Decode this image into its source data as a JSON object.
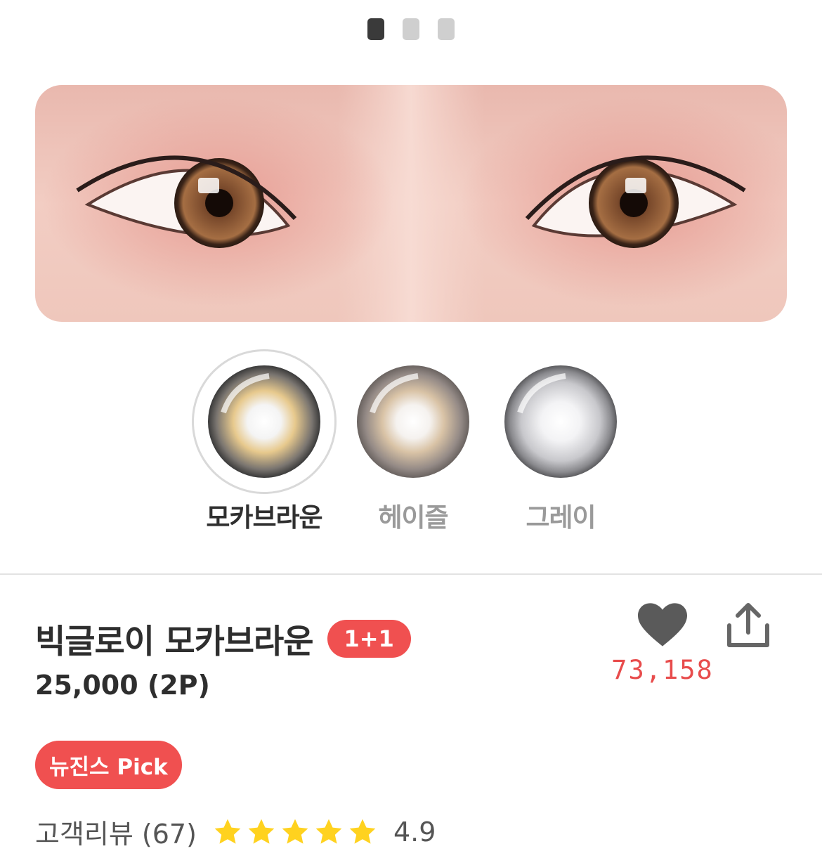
{
  "carousel": {
    "count": 3,
    "active_index": 0
  },
  "colors": {
    "accent": "#f05050",
    "like_count": "#e84c4c",
    "heart": "#5a5a5a"
  },
  "swatches": [
    {
      "label": "모카브라운",
      "selected": true
    },
    {
      "label": "헤이즐",
      "selected": false
    },
    {
      "label": "그레이",
      "selected": false
    }
  ],
  "product": {
    "title": "빅글로이 모카브라운",
    "promo_badge": "1+1",
    "price": "25,000 (2P)",
    "tag": "뉴진스 Pick",
    "like_count": "73,158"
  },
  "review": {
    "label": "고객리뷰 (67)",
    "rating": "4.9",
    "stars": 5
  },
  "icons": {
    "like": "heart-icon",
    "share": "share-icon",
    "star": "star-icon"
  }
}
